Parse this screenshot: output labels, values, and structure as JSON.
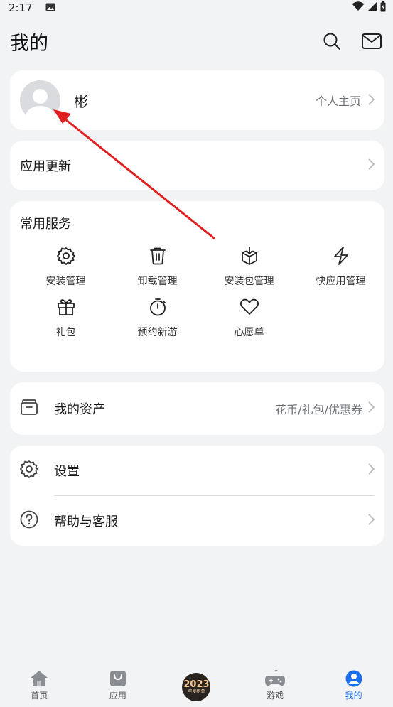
{
  "status_bar": {
    "time": "2:17"
  },
  "header": {
    "title": "我的"
  },
  "profile": {
    "name": "彬",
    "homepage_label": "个人主页"
  },
  "app_update": {
    "label": "应用更新"
  },
  "services": {
    "title": "常用服务",
    "items": [
      {
        "label": "安装管理",
        "icon": "gear-icon"
      },
      {
        "label": "卸载管理",
        "icon": "trash-icon"
      },
      {
        "label": "安装包管理",
        "icon": "package-icon"
      },
      {
        "label": "快应用管理",
        "icon": "lightning-icon"
      },
      {
        "label": "礼包",
        "icon": "gift-icon"
      },
      {
        "label": "预约新游",
        "icon": "timer-icon"
      },
      {
        "label": "心愿单",
        "icon": "heart-icon"
      }
    ]
  },
  "assets": {
    "label": "我的资产",
    "sub": "花币/礼包/优惠券"
  },
  "settings": {
    "items": [
      {
        "label": "设置",
        "icon": "gear-icon"
      },
      {
        "label": "帮助与客服",
        "icon": "help-icon"
      }
    ]
  },
  "tabbar": {
    "tabs": [
      {
        "label": "首页",
        "icon": "home-icon"
      },
      {
        "label": "应用",
        "icon": "bag-icon"
      },
      {
        "label": "",
        "icon": "year-badge-icon"
      },
      {
        "label": "游戏",
        "icon": "gamepad-icon"
      },
      {
        "label": "我的",
        "icon": "profile-icon",
        "active": true
      }
    ],
    "badge_year": "2023",
    "badge_sub": "年度榜单"
  },
  "colors": {
    "accent": "#1e6ff0",
    "annotation_arrow": "#e02020",
    "background": "#f1f3f5"
  }
}
